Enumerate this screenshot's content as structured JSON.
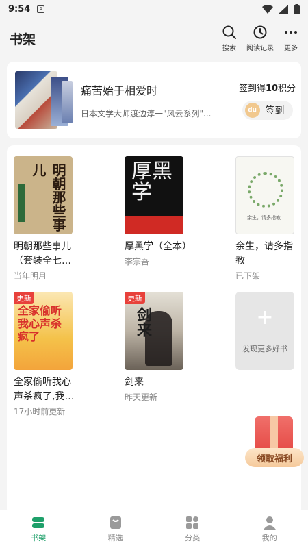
{
  "status": {
    "time": "9:54"
  },
  "header": {
    "title": "书架",
    "actions": [
      {
        "label": "搜索",
        "icon": "search-icon"
      },
      {
        "label": "阅读记录",
        "icon": "history-clock-icon"
      },
      {
        "label": "更多",
        "icon": "more-dots-icon"
      }
    ]
  },
  "recommend": {
    "title": "痛苦始于相爱时",
    "subtitle": "日本文学大师渡边淳一\"风云系列\"...",
    "checkin_text_prefix": "签到得",
    "checkin_points": "10",
    "checkin_text_suffix": "积分",
    "checkin_coin": "du",
    "checkin_button": "签到"
  },
  "books": [
    {
      "title": "明朝那些事儿（套装全七…",
      "meta": "当年明月",
      "badge": "",
      "cover_text": "明朝那些事儿"
    },
    {
      "title": "厚黑学（全本）",
      "meta": "李宗吾",
      "badge": "",
      "cover_text": "厚黑学"
    },
    {
      "title": "余生，请多指教",
      "meta": "已下架",
      "badge": "",
      "cover_text": "余生，请多指教"
    },
    {
      "title": "全家偷听我心声杀疯了,我…",
      "meta": "17小时前更新",
      "badge": "更新",
      "cover_text": "全家偷听我心声杀疯了"
    },
    {
      "title": "剑来",
      "meta": "昨天更新",
      "badge": "更新",
      "cover_text": "剑来"
    }
  ],
  "discover": {
    "label": "发现更多好书",
    "icon": "plus-icon"
  },
  "gift": {
    "label": "领取福利"
  },
  "tabs": [
    {
      "label": "书架",
      "icon": "bookshelf-icon",
      "active": true
    },
    {
      "label": "精选",
      "icon": "featured-icon",
      "active": false
    },
    {
      "label": "分类",
      "icon": "category-icon",
      "active": false
    },
    {
      "label": "我的",
      "icon": "profile-icon",
      "active": false
    }
  ],
  "colors": {
    "accent": "#1ea06a",
    "badge": "#e8413b"
  }
}
